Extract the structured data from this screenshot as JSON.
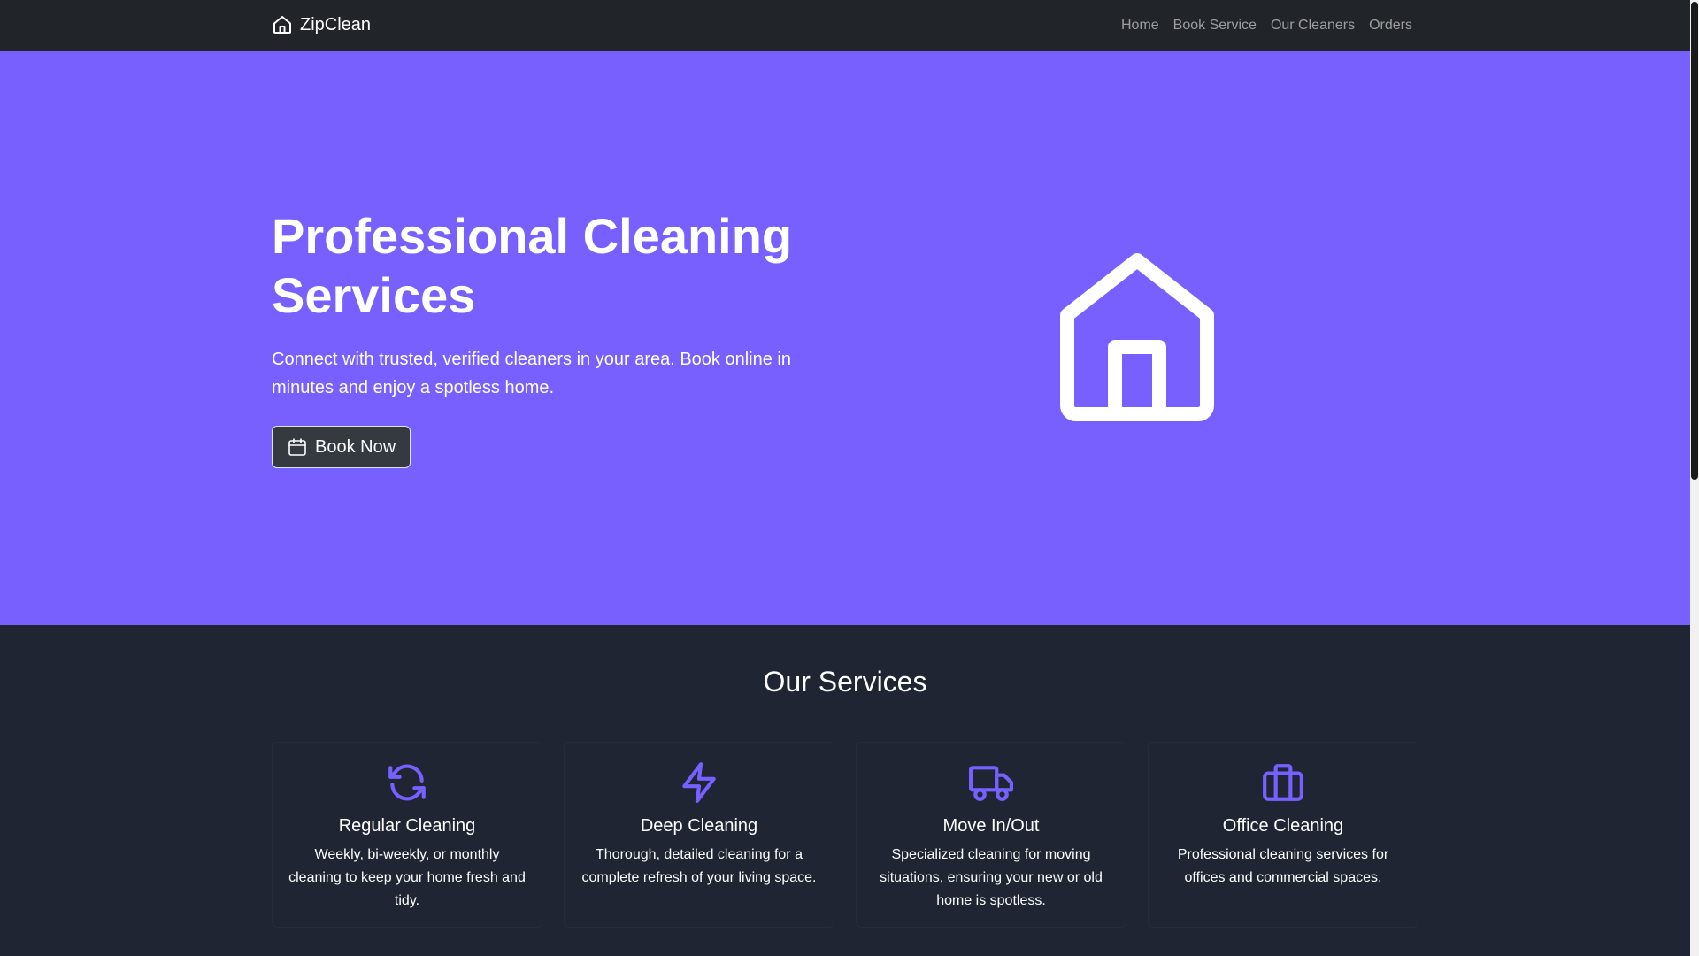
{
  "navbar": {
    "brand": "ZipClean",
    "links": [
      "Home",
      "Book Service",
      "Our Cleaners",
      "Orders"
    ]
  },
  "hero": {
    "title": "Professional Cleaning Services",
    "subtitle": "Connect with trusted, verified cleaners in your area. Book online in minutes and enjoy a spotless home.",
    "cta_label": "Book Now"
  },
  "services": {
    "heading": "Our Services",
    "items": [
      {
        "title": "Regular Cleaning",
        "text": "Weekly, bi-weekly, or monthly cleaning to keep your home fresh and tidy.",
        "icon": "refresh-icon"
      },
      {
        "title": "Deep Cleaning",
        "text": "Thorough, detailed cleaning for a complete refresh of your living space.",
        "icon": "lightning-icon"
      },
      {
        "title": "Move In/Out",
        "text": "Specialized cleaning for moving situations, ensuring your new or old home is spotless.",
        "icon": "truck-icon"
      },
      {
        "title": "Office Cleaning",
        "text": "Professional cleaning services for offices and commercial spaces.",
        "icon": "briefcase-icon"
      }
    ]
  },
  "colors": {
    "accent": "#7760ff",
    "navbar": "#212529",
    "page_bg": "#1f2532"
  }
}
